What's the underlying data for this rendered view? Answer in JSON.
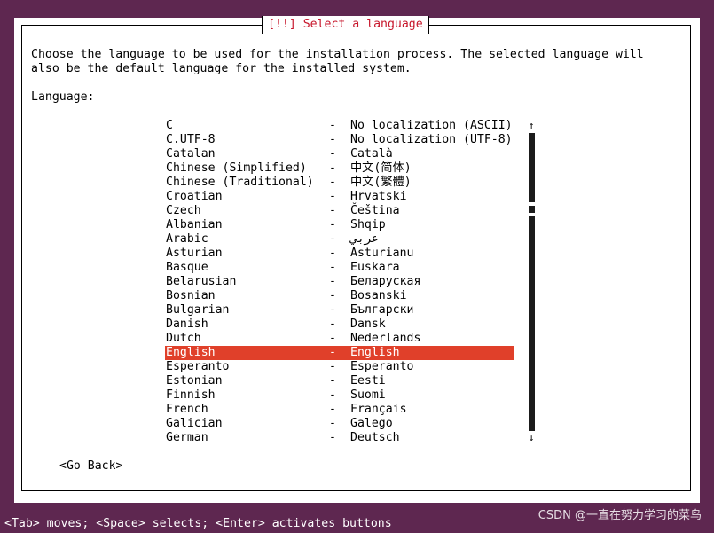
{
  "dialog": {
    "title": "[!!] Select a language",
    "description_line1": "Choose the language to be used for the installation process. The selected language will",
    "description_line2": "also be the default language for the installed system.",
    "language_label": "Language:",
    "selected_language": "English",
    "go_back_label": "<Go Back>"
  },
  "languages": [
    {
      "name": "C",
      "separator": "-",
      "native": "No localization (ASCII)"
    },
    {
      "name": "C.UTF-8",
      "separator": "-",
      "native": "No localization (UTF-8)"
    },
    {
      "name": "Catalan",
      "separator": "-",
      "native": "Català"
    },
    {
      "name": "Chinese (Simplified)",
      "separator": "-",
      "native": "中文(简体)"
    },
    {
      "name": "Chinese (Traditional)",
      "separator": "-",
      "native": "中文(繁體)"
    },
    {
      "name": "Croatian",
      "separator": "-",
      "native": "Hrvatski"
    },
    {
      "name": "Czech",
      "separator": "-",
      "native": "Čeština"
    },
    {
      "name": "Albanian",
      "separator": "-",
      "native": "Shqip"
    },
    {
      "name": "Arabic",
      "separator": "-",
      "native": "عربي"
    },
    {
      "name": "Asturian",
      "separator": "-",
      "native": "Asturianu"
    },
    {
      "name": "Basque",
      "separator": "-",
      "native": "Euskara"
    },
    {
      "name": "Belarusian",
      "separator": "-",
      "native": "Беларуская"
    },
    {
      "name": "Bosnian",
      "separator": "-",
      "native": "Bosanski"
    },
    {
      "name": "Bulgarian",
      "separator": "-",
      "native": "Български"
    },
    {
      "name": "Danish",
      "separator": "-",
      "native": "Dansk"
    },
    {
      "name": "Dutch",
      "separator": "-",
      "native": "Nederlands"
    },
    {
      "name": "English",
      "separator": "-",
      "native": "English"
    },
    {
      "name": "Esperanto",
      "separator": "-",
      "native": "Esperanto"
    },
    {
      "name": "Estonian",
      "separator": "-",
      "native": "Eesti"
    },
    {
      "name": "Finnish",
      "separator": "-",
      "native": "Suomi"
    },
    {
      "name": "French",
      "separator": "-",
      "native": "Français"
    },
    {
      "name": "Galician",
      "separator": "-",
      "native": "Galego"
    },
    {
      "name": "German",
      "separator": "-",
      "native": "Deutsch"
    }
  ],
  "scrollbar": {
    "up_arrow": "↑",
    "down_arrow": "↓",
    "position": 0.25
  },
  "status_bar": {
    "text": "<Tab> moves; <Space> selects; <Enter> activates buttons"
  },
  "watermark": {
    "text": "CSDN @一直在努力学习的菜鸟"
  },
  "colors": {
    "background": "#5e2750",
    "dialog": "#ffffff",
    "title": "#c7162b",
    "selection": "#e0402a",
    "status_text": "#ffffff"
  }
}
